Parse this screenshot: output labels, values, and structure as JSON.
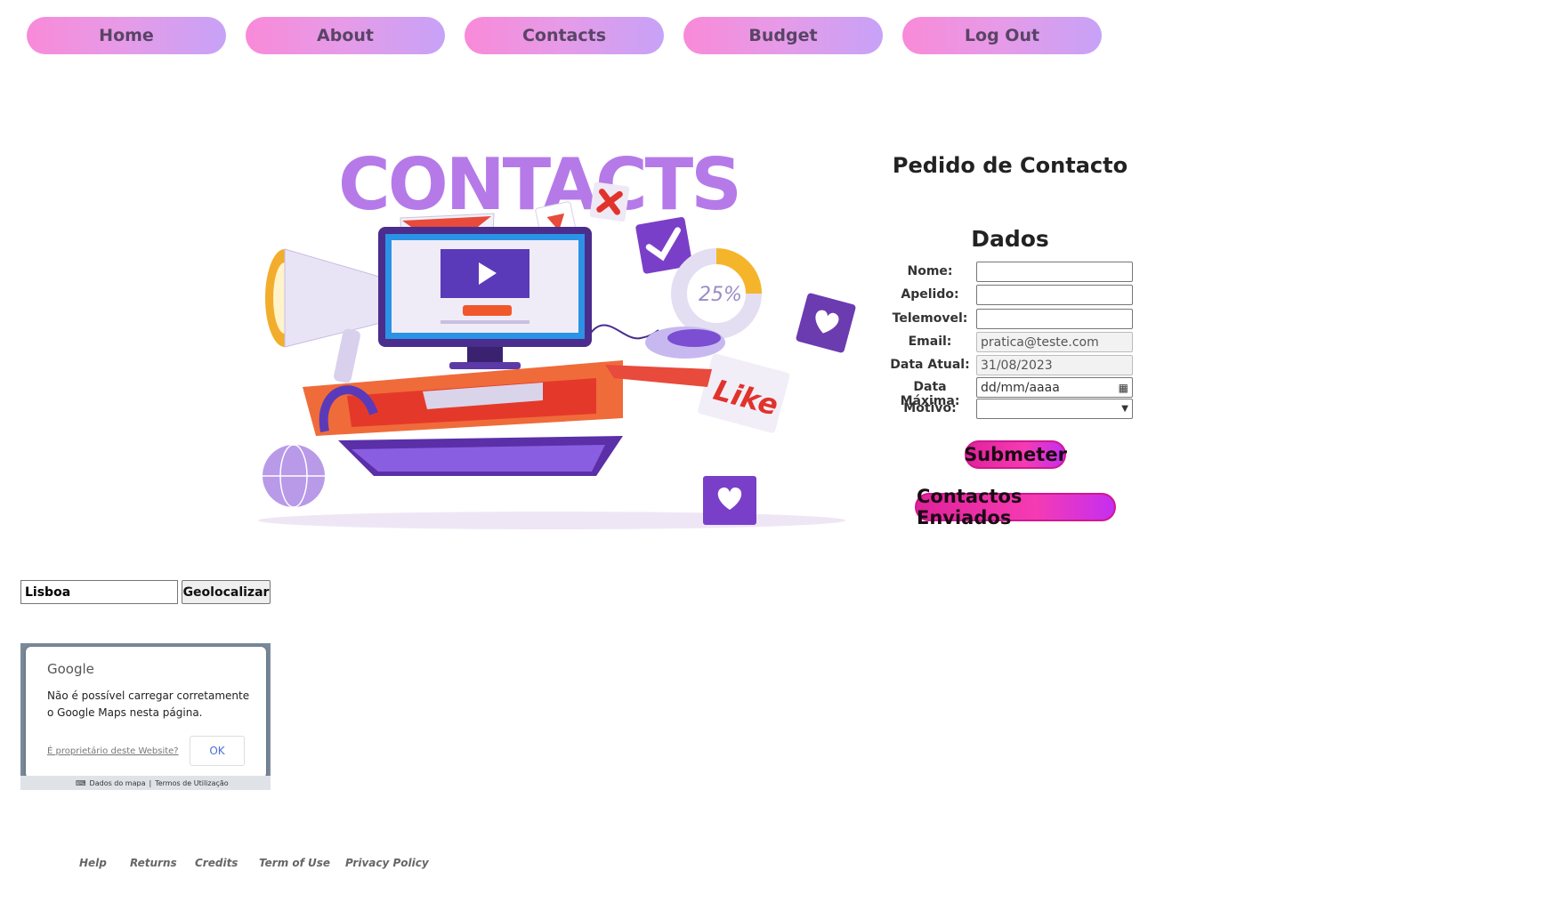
{
  "nav": {
    "items": [
      {
        "label": "Home"
      },
      {
        "label": "About"
      },
      {
        "label": "Contacts"
      },
      {
        "label": "Budget"
      },
      {
        "label": "Log Out"
      }
    ]
  },
  "hero": {
    "title": "CONTACTS",
    "progress_label": "25%",
    "like_label": "Like"
  },
  "form": {
    "title": "Pedido de Contacto",
    "section": "Dados",
    "labels": {
      "nome": "Nome:",
      "apelido": "Apelido:",
      "telemovel": "Telemovel:",
      "email": "Email:",
      "data_atual": "Data Atual:",
      "data_maxima": "Data Máxima:",
      "motivo": "Motivo:"
    },
    "values": {
      "nome": "",
      "apelido": "",
      "telemovel": "",
      "email": "pratica@teste.com",
      "data_atual": "31/08/2023",
      "data_maxima_placeholder": "dd/mm/aaaa",
      "motivo": ""
    },
    "submit_label": "Submeter",
    "sent_label": "Contactos Enviados"
  },
  "geo": {
    "city_value": "Lisboa",
    "button_label": "Geolocalizar"
  },
  "map": {
    "brand": "Google",
    "message": "Não é possível carregar corretamente o Google Maps nesta página.",
    "owner_link": "É proprietário deste Website?",
    "ok_label": "OK",
    "footer_data": "Dados do mapa",
    "footer_terms": "Termos de Utilização"
  },
  "footer": {
    "links": [
      {
        "label": "Help"
      },
      {
        "label": "Returns"
      },
      {
        "label": "Credits"
      },
      {
        "label": "Term of Use"
      },
      {
        "label": "Privacy Policy"
      }
    ]
  },
  "colors": {
    "nav_gradient_start": "#f98ad8",
    "nav_gradient_end": "#c7a2f7",
    "accent_pink": "#e0229a",
    "hero_title": "#b57ae8"
  }
}
